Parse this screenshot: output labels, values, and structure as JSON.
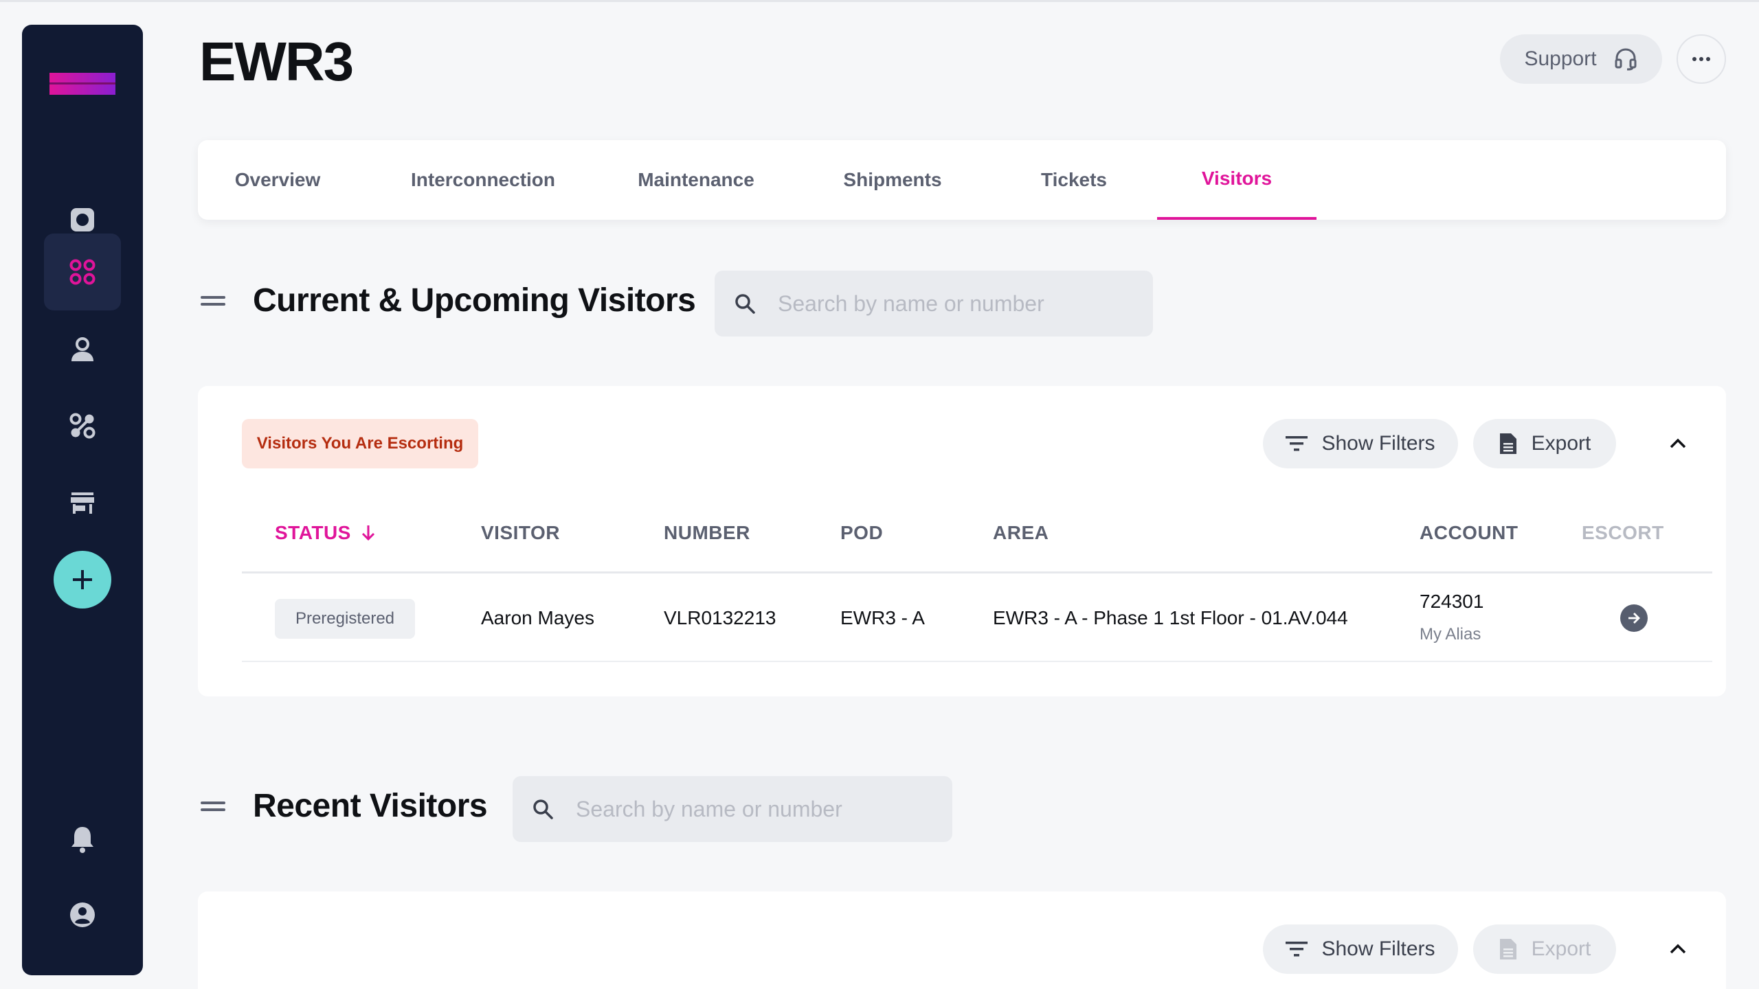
{
  "page": {
    "title": "EWR3",
    "support_label": "Support"
  },
  "colors": {
    "accent": "#e0149a",
    "sidebar_bg": "#111a33",
    "add_button": "#6ad8d5",
    "escort_chip_bg": "#fde6e0",
    "escort_chip_text": "#b52d10"
  },
  "sidebar": {
    "logo": "brand-logo",
    "items": [
      {
        "icon": "camera-square-icon",
        "active": false
      },
      {
        "icon": "grid-dots-icon",
        "active": true
      },
      {
        "icon": "user-icon",
        "active": false
      },
      {
        "icon": "interconnect-icon",
        "active": false
      },
      {
        "icon": "store-icon",
        "active": false
      }
    ],
    "add_icon": "plus-icon",
    "bottom": [
      {
        "icon": "bell-icon"
      },
      {
        "icon": "account-circle-icon"
      }
    ]
  },
  "tabs": [
    {
      "label": "Overview",
      "active": false
    },
    {
      "label": "Interconnection",
      "active": false
    },
    {
      "label": "Maintenance",
      "active": false
    },
    {
      "label": "Shipments",
      "active": false
    },
    {
      "label": "Tickets",
      "active": false
    },
    {
      "label": "Visitors",
      "active": true
    }
  ],
  "current_section": {
    "title": "Current & Upcoming Visitors",
    "search_placeholder": "Search by name or number",
    "escort_chip": "Visitors You Are Escorting",
    "show_filters": "Show Filters",
    "export": "Export",
    "columns": [
      "STATUS",
      "VISITOR",
      "NUMBER",
      "POD",
      "AREA",
      "ACCOUNT",
      "ESCORT"
    ],
    "rows": [
      {
        "status": "Preregistered",
        "visitor": "Aaron Mayes",
        "number": "VLR0132213",
        "pod": "EWR3 - A",
        "area": "EWR3 - A - Phase 1 1st Floor - 01.AV.044",
        "account": "724301",
        "account_alias": "My Alias"
      }
    ]
  },
  "recent_section": {
    "title": "Recent Visitors",
    "search_placeholder": "Search by name or number",
    "show_filters": "Show Filters",
    "export": "Export"
  }
}
